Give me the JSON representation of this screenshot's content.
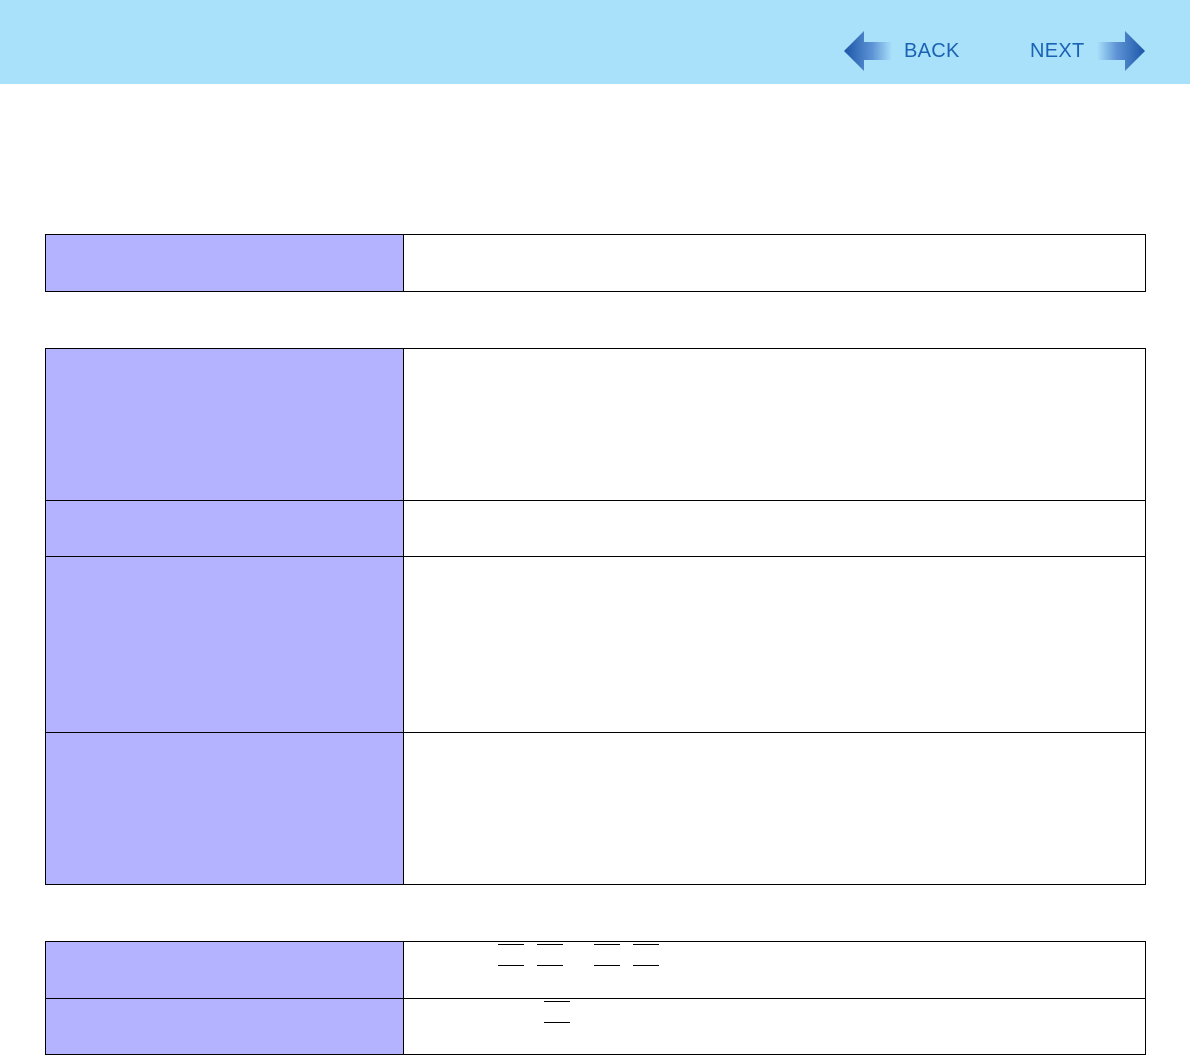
{
  "header": {
    "back_label": "BACK",
    "next_label": "NEXT",
    "back_icon": "left-arrow-icon",
    "next_icon": "right-arrow-icon",
    "bar_color": "#a9e1fa",
    "accent_color": "#1a63b4"
  },
  "tables": {
    "key_cell_color": "#b3b3ff",
    "table_1": {
      "rows": 1
    },
    "table_2": {
      "rows": 4
    },
    "table_3": {
      "rows": 2
    }
  }
}
